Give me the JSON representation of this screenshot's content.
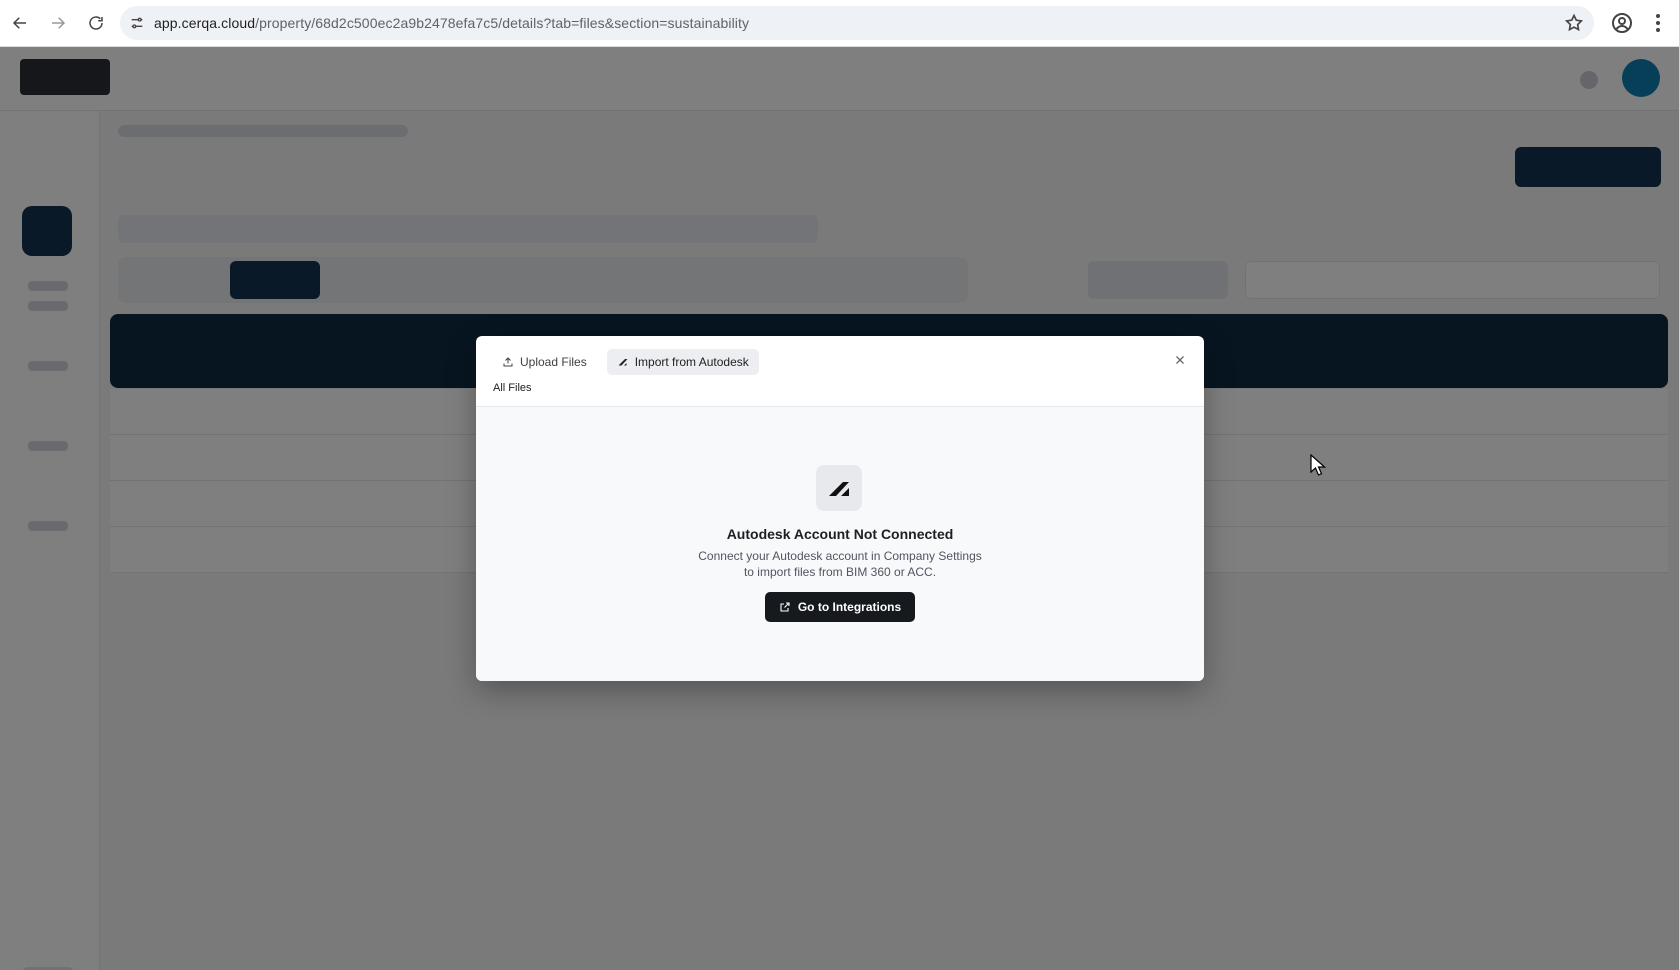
{
  "browser": {
    "url_host": "app.cerqa.cloud",
    "url_path": "/property/68d2c500ec2a9b2478efa7c5/details?tab=files&section=sustainability"
  },
  "modal": {
    "tabs": [
      {
        "label": "Upload Files",
        "icon": "upload-icon",
        "active": false
      },
      {
        "label": "Import from Autodesk",
        "icon": "autodesk-icon",
        "active": true
      }
    ],
    "folder_label": "All Files",
    "empty_state": {
      "icon": "autodesk-icon",
      "title": "Autodesk Account Not Connected",
      "description_line1": "Connect your Autodesk account in Company Settings",
      "description_line2": "to import files from BIM 360 or ACC.",
      "button_label": "Go to Integrations",
      "button_icon": "external-link-icon"
    }
  },
  "colors": {
    "primary_dark": "#16191d",
    "app_navy": "#12324f",
    "overlay": "rgba(0,0,0,0.5)"
  }
}
